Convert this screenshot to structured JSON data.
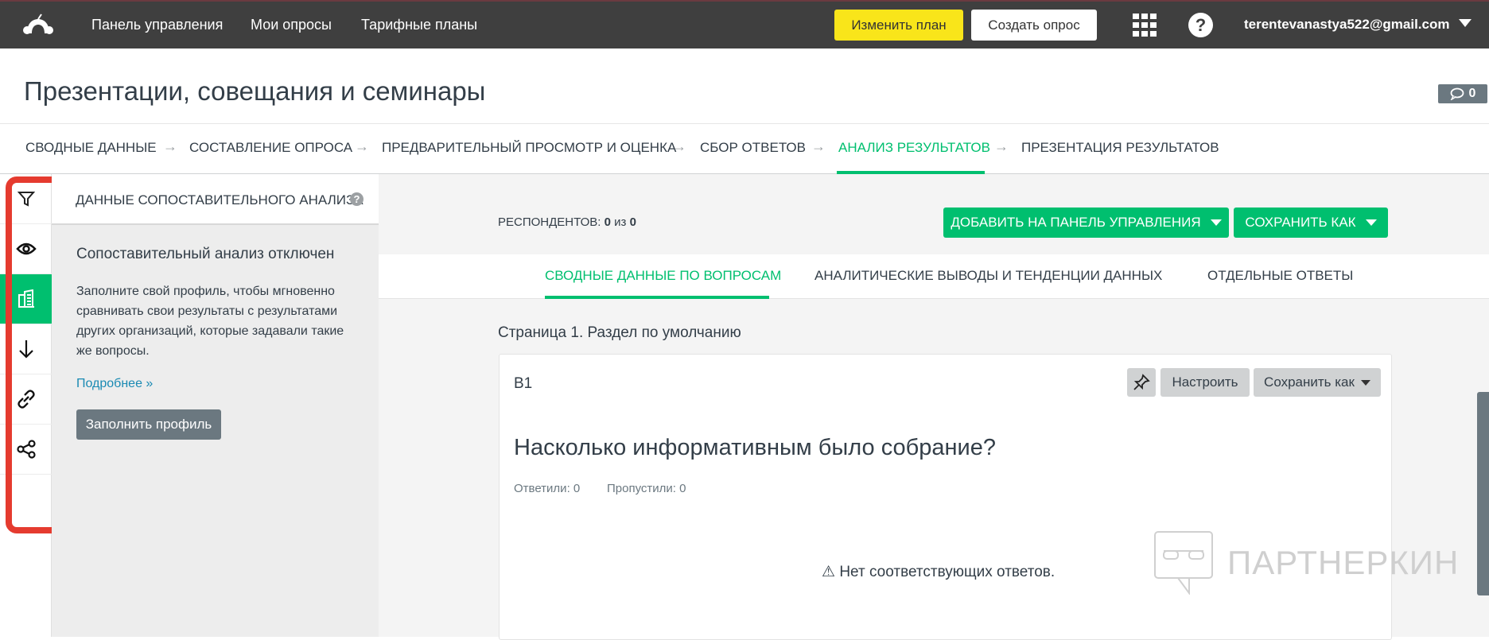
{
  "topbar": {
    "nav": [
      "Панель управления",
      "Мои опросы",
      "Тарифные планы"
    ],
    "upgrade_label": "Изменить план",
    "create_label": "Создать опрос",
    "email": "terentevanastya522@gmail.com"
  },
  "header": {
    "title": "Презентации, совещания и семинары",
    "comments_count": "0"
  },
  "breadcrumbs": [
    "СВОДНЫЕ ДАННЫЕ",
    "СОСТАВЛЕНИЕ ОПРОСА",
    "ПРЕДВАРИТЕЛЬНЫЙ ПРОСМОТР И ОЦЕНКА",
    "СБОР ОТВЕТОВ",
    "АНАЛИЗ РЕЗУЛЬТАТОВ",
    "ПРЕЗЕНТАЦИЯ РЕЗУЛЬТАТОВ"
  ],
  "active_breadcrumb": "АНАЛИЗ РЕЗУЛЬТАТОВ",
  "sidebar": {
    "icons": [
      "filter-icon",
      "eye-icon",
      "benchmark-icon",
      "download-icon",
      "link-icon",
      "share-icon"
    ],
    "active": "benchmark-icon"
  },
  "panel": {
    "header": "ДАННЫЕ СОПОСТАВИТЕЛЬНОГО АНАЛИЗА",
    "heading": "Сопоставительный анализ отключен",
    "text": "Заполните свой профиль, чтобы мгновенно сравнивать свои результаты с результатами других организаций, которые задавали такие же вопросы.",
    "link": "Подробнее »",
    "button": "Заполнить профиль"
  },
  "main": {
    "respondents_label": "РЕСПОНДЕНТОВ:",
    "respondents_shown": "0",
    "respondents_of": "из",
    "respondents_total": "0",
    "add_dashboard": "ДОБАВИТЬ НА ПАНЕЛЬ УПРАВЛЕНИЯ",
    "save_as": "СОХРАНИТЬ КАК",
    "tabs": [
      "СВОДНЫЕ ДАННЫЕ ПО ВОПРОСАМ",
      "АНАЛИТИЧЕСКИЕ ВЫВОДЫ И ТЕНДЕНЦИИ ДАННЫХ",
      "ОТДЕЛЬНЫЕ ОТВЕТЫ"
    ],
    "page_heading": "Страница 1. Раздел по умолчанию",
    "question": {
      "id": "В1",
      "configure": "Настроить",
      "save_as": "Сохранить как",
      "text": "Насколько информативным было собрание?",
      "answered": "Ответили: 0",
      "skipped": "Пропустили: 0",
      "empty": "Нет соответствующих ответов."
    }
  },
  "watermark": "ПАРТНЕРКИН",
  "colors": {
    "accent": "#00bf6f",
    "topbar": "#3f3f3f",
    "upgrade": "#f9e51a",
    "highlight": "#e53b2f"
  }
}
